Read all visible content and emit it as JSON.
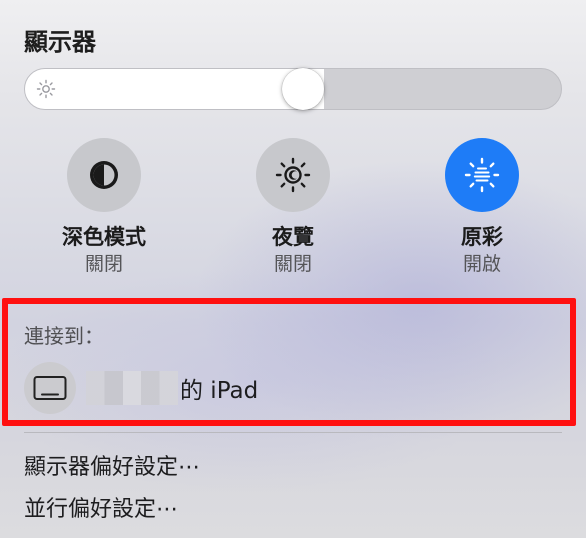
{
  "panel": {
    "title": "顯示器"
  },
  "brightness": {
    "level": 0.52,
    "icon": "sun-small-icon"
  },
  "toggles": [
    {
      "label": "深色模式",
      "status": "關閉",
      "icon": "dark-mode-icon",
      "on": false
    },
    {
      "label": "夜覽",
      "status": "關閉",
      "icon": "night-shift-icon",
      "on": false
    },
    {
      "label": "原彩",
      "status": "開啟",
      "icon": "true-tone-icon",
      "on": true
    }
  ],
  "connect": {
    "label": "連接到：",
    "device_name": "的 iPad",
    "device_icon": "ipad-icon"
  },
  "menu": {
    "display_prefs": "顯示器偏好設定⋯",
    "sidecar_prefs": "並行偏好設定⋯"
  },
  "colors": {
    "accent": "#1e7cf7",
    "highlight": "#ff1010"
  }
}
